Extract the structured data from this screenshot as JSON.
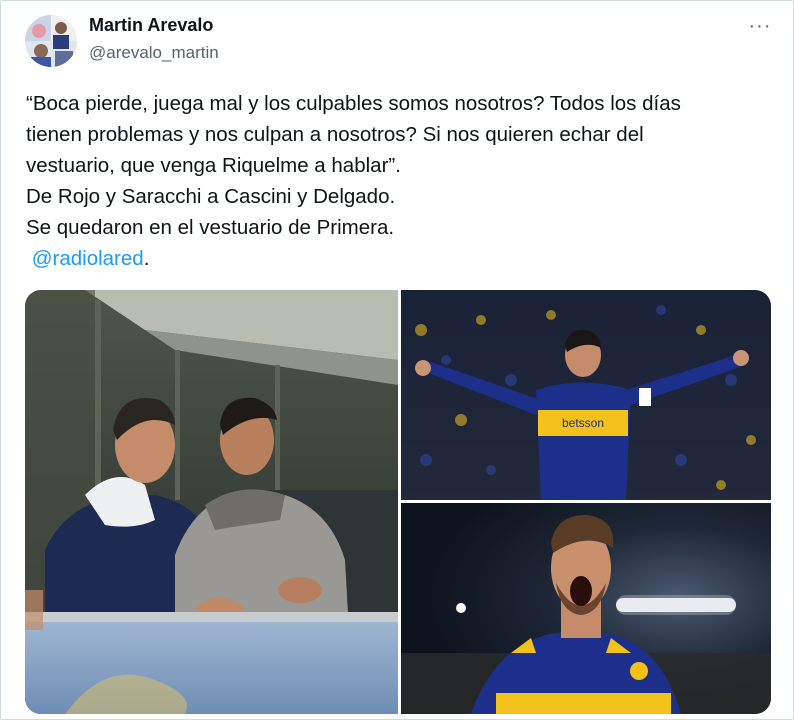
{
  "author": {
    "name": "Martin Arevalo",
    "handle": "@arevalo_martin",
    "avatar_icon": "profile-photo"
  },
  "more_icon": "more-horizontal-icon",
  "more_label": "···",
  "tweet": {
    "lines": [
      "“Boca pierde, juega mal y los culpables somos nosotros? Todos los días",
      "tienen problemas y nos culpan a nosotros? Si nos quieren echar del",
      "vestuario, que venga Riquelme a hablar”.",
      "De Rojo y Saracchi a Cascini y Delgado.",
      "Se quedaron en el vestuario de Primera."
    ],
    "mention": "@radiolared",
    "mention_suffix": "."
  },
  "media": {
    "jersey_sponsor": "betsson",
    "colors": {
      "boca_blue": "#1c2f8a",
      "boca_gold": "#f2c21a",
      "link": "#1d9bf0"
    }
  }
}
